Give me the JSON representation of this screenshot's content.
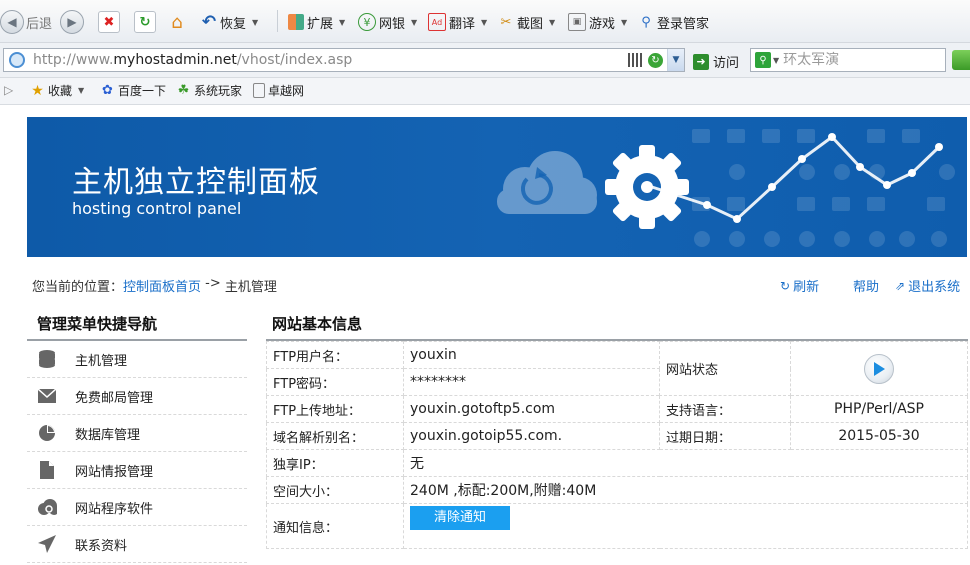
{
  "browser": {
    "back_label": "后退",
    "restore_label": "恢复",
    "menus": {
      "extend": "扩展",
      "bank": "网银",
      "translate": "翻译",
      "screenshot": "截图",
      "games": "游戏",
      "login_manager": "登录管家"
    },
    "address": {
      "url_prefix": "http://www.",
      "url_domain": "myhostadmin.net",
      "url_path": "/vhost/index.asp"
    },
    "go_label": "访问",
    "search_placeholder": "环太军演"
  },
  "favorites": {
    "collect": "收藏",
    "items": [
      "百度一下",
      "系统玩家",
      "卓越网"
    ]
  },
  "banner": {
    "title": "主机独立控制面板",
    "subtitle": "hosting control panel"
  },
  "breadcrumb": {
    "prefix": "您当前的位置：",
    "home": "控制面板首页",
    "separator": " -> ",
    "current": "主机管理"
  },
  "actions": {
    "refresh": "刷新",
    "help": "帮助",
    "logout": "退出系统"
  },
  "sidebar": {
    "title": "管理菜单快捷导航",
    "items": [
      {
        "label": "主机管理",
        "icon": "database-icon"
      },
      {
        "label": "免费邮局管理",
        "icon": "mail-icon"
      },
      {
        "label": "数据库管理",
        "icon": "pie-chart-icon"
      },
      {
        "label": "网站情报管理",
        "icon": "document-icon"
      },
      {
        "label": "网站程序软件",
        "icon": "cloud-refresh-icon"
      },
      {
        "label": "联系资料",
        "icon": "paper-plane-icon"
      }
    ]
  },
  "site_info": {
    "title": "网站基本信息",
    "ftp_user_label": "FTP用户名：",
    "ftp_user": "youxin",
    "ftp_pass_label": "FTP密码：",
    "ftp_pass": "********",
    "ftp_addr_label": "FTP上传地址：",
    "ftp_addr": "youxin.gotoftp5.com",
    "alias_label": "域名解析别名：",
    "alias": "youxin.gotoip55.com.",
    "ip_label": "独享IP：",
    "ip": "无",
    "space_label": "空间大小：",
    "space": "240M ,标配:200M,附赠:40M",
    "notice_label": "通知信息：",
    "clear_notice": "清除通知",
    "status_label": "网站状态",
    "lang_label": "支持语言：",
    "lang": "PHP/Perl/ASP",
    "expire_label": "过期日期：",
    "expire": "2015-05-30"
  },
  "colors": {
    "banner_blue": "#1463b3",
    "link_blue": "#1a6fc9",
    "button_blue": "#1b9ff0"
  }
}
